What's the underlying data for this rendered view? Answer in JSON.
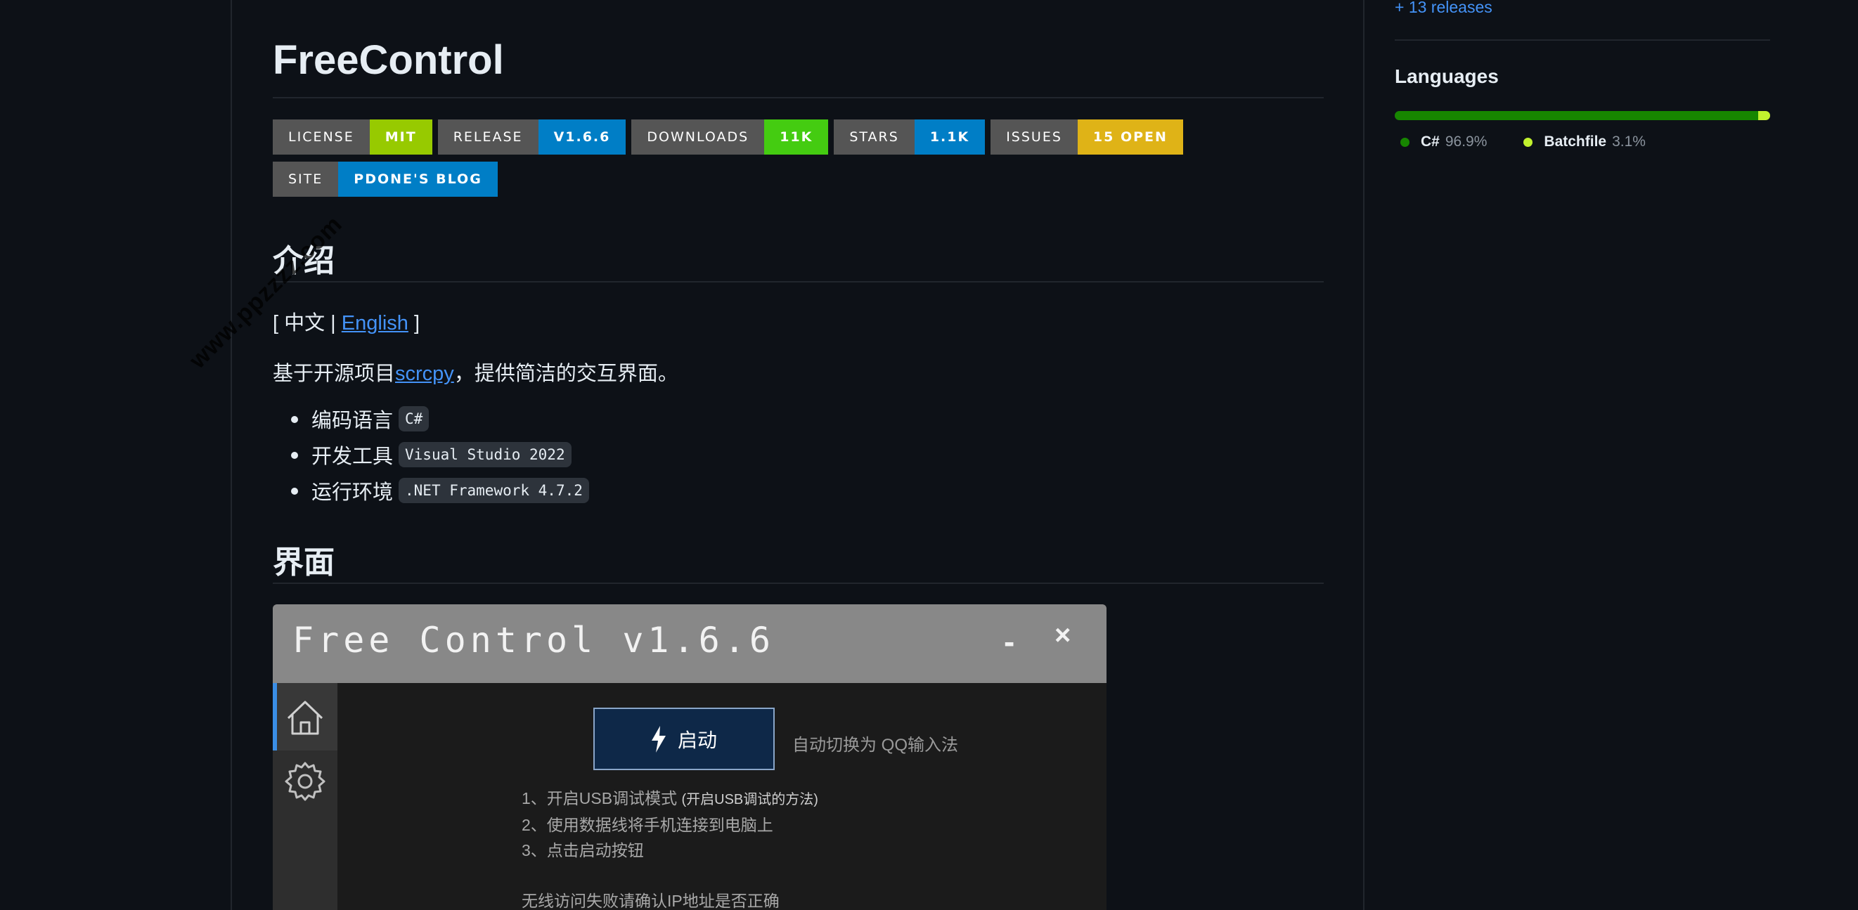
{
  "readme": {
    "title": "FreeControl",
    "badges": [
      {
        "key": "LICENSE",
        "value": "MIT",
        "color": "#97ca00"
      },
      {
        "key": "RELEASE",
        "value": "V1.6.6",
        "color": "#007ec6"
      },
      {
        "key": "DOWNLOADS",
        "value": "11K",
        "color": "#4c1"
      },
      {
        "key": "STARS",
        "value": "1.1K",
        "color": "#007ec6"
      },
      {
        "key": "ISSUES",
        "value": "15 OPEN",
        "color": "#dfb317"
      },
      {
        "key": "SITE",
        "value": "PDONE'S BLOG",
        "color": "#007ec6"
      }
    ],
    "intro_heading": "介绍",
    "lang_open": "[ 中文 |",
    "lang_link": "English",
    "lang_close": "]",
    "desc_prefix": "基于开源项目",
    "desc_link": "scrcpy",
    "desc_suffix": "，提供简洁的交互界面。",
    "list": [
      {
        "label": "编码语言",
        "code": "C#"
      },
      {
        "label": "开发工具",
        "code": "Visual Studio 2022"
      },
      {
        "label": "运行环境",
        "code": ".NET Framework 4.7.2"
      }
    ],
    "ui_heading": "界面"
  },
  "app": {
    "title": "Free Control v1.6.6",
    "minimize": "-",
    "close": "×",
    "start_label": "启动",
    "auto_switch": "自动切换为 QQ输入法",
    "step1": "1、开启USB调试模式",
    "step1_link": "(开启USB调试的方法)",
    "step2": "2、使用数据线将手机连接到电脑上",
    "step3": "3、点击启动按钮",
    "wireless_hint": "无线访问失败请确认IP地址是否正确"
  },
  "sidebar": {
    "releases_link": "+ 13 releases",
    "languages_heading": "Languages",
    "languages": [
      {
        "name": "C#",
        "percent": "96.9%",
        "share": 96.9,
        "color": "#178600"
      },
      {
        "name": "Batchfile",
        "percent": "3.1%",
        "share": 3.1,
        "color": "#c1f12e"
      }
    ]
  },
  "watermark": "www.ppzzzz.com"
}
